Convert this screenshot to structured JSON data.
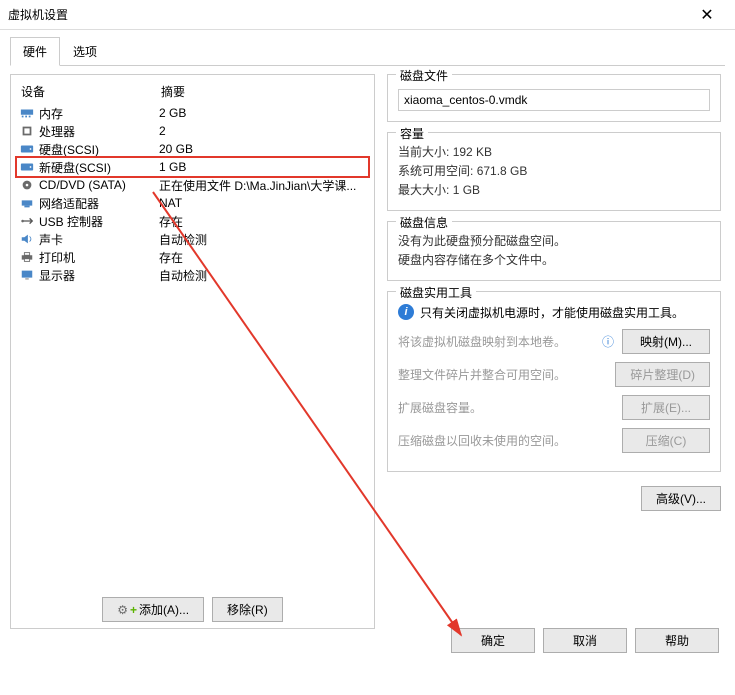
{
  "window": {
    "title": "虚拟机设置"
  },
  "tabs": {
    "hardware": "硬件",
    "options": "选项"
  },
  "devlist": {
    "col_device": "设备",
    "col_summary": "摘要",
    "items": [
      {
        "name": "内存",
        "summary": "2 GB",
        "icon": "memory"
      },
      {
        "name": "处理器",
        "summary": "2",
        "icon": "cpu"
      },
      {
        "name": "硬盘(SCSI)",
        "summary": "20 GB",
        "icon": "disk"
      },
      {
        "name": "新硬盘(SCSI)",
        "summary": "1 GB",
        "icon": "disk",
        "highlighted": true
      },
      {
        "name": "CD/DVD (SATA)",
        "summary": "正在使用文件 D:\\Ma.JinJian\\大学课...",
        "icon": "cd"
      },
      {
        "name": "网络适配器",
        "summary": "NAT",
        "icon": "net"
      },
      {
        "name": "USB 控制器",
        "summary": "存在",
        "icon": "usb"
      },
      {
        "name": "声卡",
        "summary": "自动检测",
        "icon": "sound"
      },
      {
        "name": "打印机",
        "summary": "存在",
        "icon": "printer"
      },
      {
        "name": "显示器",
        "summary": "自动检测",
        "icon": "display"
      }
    ],
    "add_btn": "添加(A)...",
    "remove_btn": "移除(R)"
  },
  "disk_file": {
    "legend": "磁盘文件",
    "value": "xiaoma_centos-0.vmdk"
  },
  "capacity": {
    "legend": "容量",
    "current_label": "当前大小:",
    "current_value": "192 KB",
    "free_label": "系统可用空间:",
    "free_value": "671.8 GB",
    "max_label": "最大大小:",
    "max_value": "1 GB"
  },
  "disk_info": {
    "legend": "磁盘信息",
    "line1": "没有为此硬盘预分配磁盘空间。",
    "line2": "硬盘内容存储在多个文件中。"
  },
  "disk_util": {
    "legend": "磁盘实用工具",
    "note": "只有关闭虚拟机电源时，才能使用磁盘实用工具。",
    "map_text": "将该虚拟机磁盘映射到本地卷。",
    "map_btn": "映射(M)...",
    "defrag_text": "整理文件碎片并整合可用空间。",
    "defrag_btn": "碎片整理(D)",
    "expand_text": "扩展磁盘容量。",
    "expand_btn": "扩展(E)...",
    "compact_text": "压缩磁盘以回收未使用的空间。",
    "compact_btn": "压缩(C)"
  },
  "advanced_btn": "高级(V)...",
  "footer": {
    "ok": "确定",
    "cancel": "取消",
    "help": "帮助"
  }
}
